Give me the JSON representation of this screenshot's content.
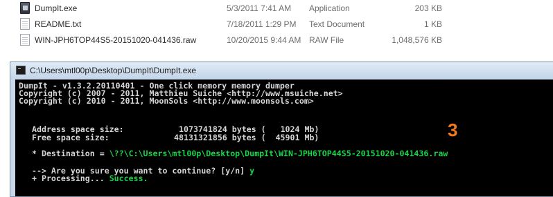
{
  "files": [
    {
      "name": "DumpIt.exe",
      "date": "5/3/2011 7:41 AM",
      "type": "Application",
      "size": "203 KB",
      "icon": "application-exe-icon"
    },
    {
      "name": "README.txt",
      "date": "7/18/2011 1:29 PM",
      "type": "Text Document",
      "size": "1 KB",
      "icon": "text-document-icon"
    },
    {
      "name": "WIN-JPH6TOP44S5-20151020-041436.raw",
      "date": "10/20/2015 9:44 AM",
      "type": "RAW File",
      "size": "1,048,576 KB",
      "icon": "raw-file-icon"
    }
  ],
  "console": {
    "title": "C:\\Users\\mtl00p\\Desktop\\DumpIt\\DumpIt.exe",
    "header": [
      "DumpIt - v1.3.2.20110401 - One click memory memory dumper",
      "Copyright (c) 2007 - 2011, Matthieu Suiche <http://www.msuiche.net>",
      "Copyright (c) 2010 - 2011, MoonSols <http://www.moonsols.com>"
    ],
    "address_label": "Address space size:",
    "address_value": "1073741824 bytes (   1024 Mb)",
    "free_label": "Free space size:",
    "free_value": "48131321856 bytes (  45901 Mb)",
    "destination_label": "* Destination = ",
    "destination_path": "\\??\\C:\\Users\\mtl00p\\Desktop\\DumpIt\\WIN-JPH6TOP44S5-20151020-041436.raw",
    "prompt": "--> Are you sure you want to continue? [y/n] ",
    "answer": "y",
    "processing": "+ Processing... ",
    "success": "Success.",
    "annotation": "3"
  },
  "colors": {
    "console_bg": "#000000",
    "console_text": "#d6d6d6",
    "console_green": "#19d34a",
    "annotation": "#f07a1c",
    "titlebar": "#c8d8ea"
  }
}
